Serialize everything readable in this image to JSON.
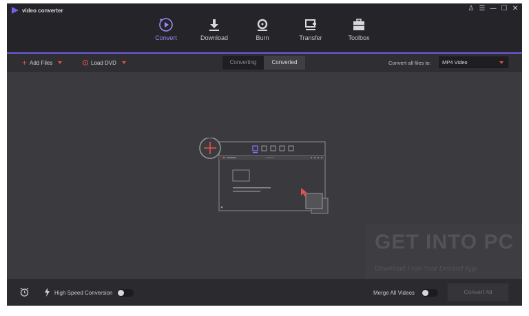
{
  "app": {
    "title": "video converter"
  },
  "window_controls": [
    {
      "name": "user-icon",
      "glyph": "♙"
    },
    {
      "name": "menu-icon",
      "glyph": "☰"
    },
    {
      "name": "minimize-icon",
      "glyph": "—"
    },
    {
      "name": "maximize-icon",
      "glyph": "☐"
    },
    {
      "name": "close-icon",
      "glyph": "✕"
    }
  ],
  "nav": {
    "tabs": [
      {
        "label": "Convert",
        "icon": "convert-icon",
        "active": true
      },
      {
        "label": "Download",
        "icon": "download-icon",
        "active": false
      },
      {
        "label": "Burn",
        "icon": "burn-icon",
        "active": false
      },
      {
        "label": "Transfer",
        "icon": "transfer-icon",
        "active": false
      },
      {
        "label": "Toolbox",
        "icon": "toolbox-icon",
        "active": false
      }
    ]
  },
  "toolbar": {
    "add_files": "Add Files",
    "load_dvd": "Load DVD",
    "segments": [
      "Converting",
      "Converted"
    ],
    "active_segment": "Converted",
    "convert_all_label": "Convert all files to:",
    "format_value": "MP4 Video"
  },
  "watermark": {
    "main": "GET INTO PC",
    "sub": "Download Free Your Desired App"
  },
  "bottom": {
    "high_speed_label": "High Speed Conversion",
    "high_speed_on": false,
    "merge_label": "Merge All Videos",
    "merge_on": false,
    "convert_all_button": "Convert All"
  },
  "colors": {
    "accent": "#6f59e0",
    "active_tab_text": "#9b8cf5",
    "highlight_red": "#e0544a"
  }
}
